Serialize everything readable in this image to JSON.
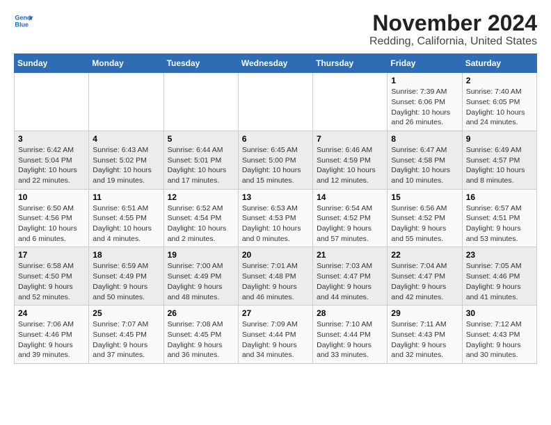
{
  "header": {
    "logo_line1": "General",
    "logo_line2": "Blue",
    "title": "November 2024",
    "subtitle": "Redding, California, United States"
  },
  "weekdays": [
    "Sunday",
    "Monday",
    "Tuesday",
    "Wednesday",
    "Thursday",
    "Friday",
    "Saturday"
  ],
  "weeks": [
    [
      {
        "day": "",
        "detail": ""
      },
      {
        "day": "",
        "detail": ""
      },
      {
        "day": "",
        "detail": ""
      },
      {
        "day": "",
        "detail": ""
      },
      {
        "day": "",
        "detail": ""
      },
      {
        "day": "1",
        "detail": "Sunrise: 7:39 AM\nSunset: 6:06 PM\nDaylight: 10 hours\nand 26 minutes."
      },
      {
        "day": "2",
        "detail": "Sunrise: 7:40 AM\nSunset: 6:05 PM\nDaylight: 10 hours\nand 24 minutes."
      }
    ],
    [
      {
        "day": "3",
        "detail": "Sunrise: 6:42 AM\nSunset: 5:04 PM\nDaylight: 10 hours\nand 22 minutes."
      },
      {
        "day": "4",
        "detail": "Sunrise: 6:43 AM\nSunset: 5:02 PM\nDaylight: 10 hours\nand 19 minutes."
      },
      {
        "day": "5",
        "detail": "Sunrise: 6:44 AM\nSunset: 5:01 PM\nDaylight: 10 hours\nand 17 minutes."
      },
      {
        "day": "6",
        "detail": "Sunrise: 6:45 AM\nSunset: 5:00 PM\nDaylight: 10 hours\nand 15 minutes."
      },
      {
        "day": "7",
        "detail": "Sunrise: 6:46 AM\nSunset: 4:59 PM\nDaylight: 10 hours\nand 12 minutes."
      },
      {
        "day": "8",
        "detail": "Sunrise: 6:47 AM\nSunset: 4:58 PM\nDaylight: 10 hours\nand 10 minutes."
      },
      {
        "day": "9",
        "detail": "Sunrise: 6:49 AM\nSunset: 4:57 PM\nDaylight: 10 hours\nand 8 minutes."
      }
    ],
    [
      {
        "day": "10",
        "detail": "Sunrise: 6:50 AM\nSunset: 4:56 PM\nDaylight: 10 hours\nand 6 minutes."
      },
      {
        "day": "11",
        "detail": "Sunrise: 6:51 AM\nSunset: 4:55 PM\nDaylight: 10 hours\nand 4 minutes."
      },
      {
        "day": "12",
        "detail": "Sunrise: 6:52 AM\nSunset: 4:54 PM\nDaylight: 10 hours\nand 2 minutes."
      },
      {
        "day": "13",
        "detail": "Sunrise: 6:53 AM\nSunset: 4:53 PM\nDaylight: 10 hours\nand 0 minutes."
      },
      {
        "day": "14",
        "detail": "Sunrise: 6:54 AM\nSunset: 4:52 PM\nDaylight: 9 hours\nand 57 minutes."
      },
      {
        "day": "15",
        "detail": "Sunrise: 6:56 AM\nSunset: 4:52 PM\nDaylight: 9 hours\nand 55 minutes."
      },
      {
        "day": "16",
        "detail": "Sunrise: 6:57 AM\nSunset: 4:51 PM\nDaylight: 9 hours\nand 53 minutes."
      }
    ],
    [
      {
        "day": "17",
        "detail": "Sunrise: 6:58 AM\nSunset: 4:50 PM\nDaylight: 9 hours\nand 52 minutes."
      },
      {
        "day": "18",
        "detail": "Sunrise: 6:59 AM\nSunset: 4:49 PM\nDaylight: 9 hours\nand 50 minutes."
      },
      {
        "day": "19",
        "detail": "Sunrise: 7:00 AM\nSunset: 4:49 PM\nDaylight: 9 hours\nand 48 minutes."
      },
      {
        "day": "20",
        "detail": "Sunrise: 7:01 AM\nSunset: 4:48 PM\nDaylight: 9 hours\nand 46 minutes."
      },
      {
        "day": "21",
        "detail": "Sunrise: 7:03 AM\nSunset: 4:47 PM\nDaylight: 9 hours\nand 44 minutes."
      },
      {
        "day": "22",
        "detail": "Sunrise: 7:04 AM\nSunset: 4:47 PM\nDaylight: 9 hours\nand 42 minutes."
      },
      {
        "day": "23",
        "detail": "Sunrise: 7:05 AM\nSunset: 4:46 PM\nDaylight: 9 hours\nand 41 minutes."
      }
    ],
    [
      {
        "day": "24",
        "detail": "Sunrise: 7:06 AM\nSunset: 4:46 PM\nDaylight: 9 hours\nand 39 minutes."
      },
      {
        "day": "25",
        "detail": "Sunrise: 7:07 AM\nSunset: 4:45 PM\nDaylight: 9 hours\nand 37 minutes."
      },
      {
        "day": "26",
        "detail": "Sunrise: 7:08 AM\nSunset: 4:45 PM\nDaylight: 9 hours\nand 36 minutes."
      },
      {
        "day": "27",
        "detail": "Sunrise: 7:09 AM\nSunset: 4:44 PM\nDaylight: 9 hours\nand 34 minutes."
      },
      {
        "day": "28",
        "detail": "Sunrise: 7:10 AM\nSunset: 4:44 PM\nDaylight: 9 hours\nand 33 minutes."
      },
      {
        "day": "29",
        "detail": "Sunrise: 7:11 AM\nSunset: 4:43 PM\nDaylight: 9 hours\nand 32 minutes."
      },
      {
        "day": "30",
        "detail": "Sunrise: 7:12 AM\nSunset: 4:43 PM\nDaylight: 9 hours\nand 30 minutes."
      }
    ]
  ]
}
